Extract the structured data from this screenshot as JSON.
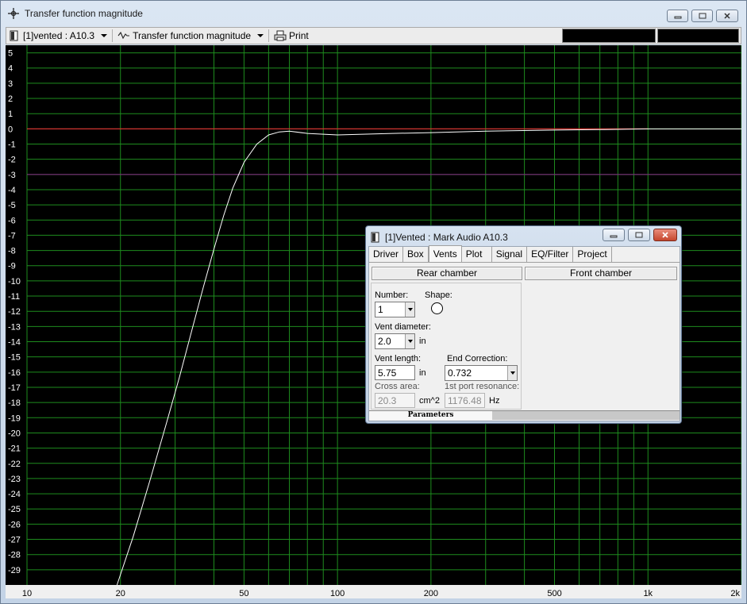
{
  "window": {
    "title": "Transfer function magnitude",
    "icon": "crosshair-icon",
    "caption_buttons": [
      "minimize-icon",
      "maximize-icon",
      "close-icon"
    ]
  },
  "toolbar": {
    "project_selector": "[1]vented : A10.3",
    "view_selector": "Transfer function magnitude",
    "print_label": "Print"
  },
  "dialog": {
    "title": "[1]Vented : Mark Audio A10.3",
    "tabs": [
      "Driver",
      "Box",
      "Vents",
      "Plot",
      "Signal",
      "EQ/Filter",
      "Project"
    ],
    "active_tab": "Vents",
    "rear_chamber_label": "Rear chamber",
    "front_chamber_label": "Front chamber",
    "number_label": "Number:",
    "number_value": "1",
    "shape_label": "Shape:",
    "vent_diameter_label": "Vent diameter:",
    "vent_diameter_value": "2.0",
    "vent_diameter_unit": "in",
    "vent_length_label": "Vent length:",
    "vent_length_value": "5.75",
    "vent_length_unit": "in",
    "end_correction_label": "End Correction:",
    "end_correction_value": "0.732",
    "cross_area_label": "Cross area:",
    "cross_area_value": "20.3",
    "cross_area_unit": "cm^2",
    "port_resonance_label": "1st port resonance:",
    "port_resonance_value": "1176.48",
    "port_resonance_unit": "Hz",
    "bottom_tab_label": "Parameters"
  },
  "chart_data": {
    "type": "line",
    "x_scale": "log",
    "xlim": [
      10,
      2000
    ],
    "ylim": [
      -30,
      5.5
    ],
    "x_tick_labels": [
      {
        "value": 10,
        "label": "10"
      },
      {
        "value": 20,
        "label": "20"
      },
      {
        "value": 50,
        "label": "50"
      },
      {
        "value": 100,
        "label": "100"
      },
      {
        "value": 200,
        "label": "200"
      },
      {
        "value": 500,
        "label": "500"
      },
      {
        "value": 1000,
        "label": "1k"
      },
      {
        "value": 2000,
        "label": "2k"
      }
    ],
    "y_ticks": [
      5,
      4,
      3,
      2,
      1,
      0,
      -1,
      -2,
      -3,
      -4,
      -5,
      -6,
      -7,
      -8,
      -9,
      -10,
      -11,
      -12,
      -13,
      -14,
      -15,
      -16,
      -17,
      -18,
      -19,
      -20,
      -21,
      -22,
      -23,
      -24,
      -25,
      -26,
      -27,
      -28,
      -29
    ],
    "grid": true,
    "reference_lines": [
      {
        "y": 0,
        "color": "#d23030",
        "x_end": 1000
      },
      {
        "y": -3,
        "color": "#7a2a7a"
      }
    ],
    "series": [
      {
        "color": "#ffffff",
        "x": [
          19.5,
          22,
          25,
          28,
          31,
          34,
          37,
          40,
          43,
          46,
          50,
          55,
          60,
          65,
          70,
          80,
          100,
          150,
          200,
          300,
          500,
          700,
          1000,
          1500,
          2000
        ],
        "y": [
          -30,
          -26.8,
          -23,
          -19.5,
          -16.3,
          -13.2,
          -10.4,
          -7.9,
          -5.7,
          -3.9,
          -2.2,
          -1.0,
          -0.4,
          -0.2,
          -0.15,
          -0.3,
          -0.4,
          -0.3,
          -0.25,
          -0.15,
          -0.08,
          -0.05,
          0,
          0,
          0
        ]
      }
    ]
  },
  "colors": {
    "plot_background": "#000000",
    "grid": "#1e8c1e",
    "axis_text": "#ffffff",
    "bottom_axis_text": "#000000"
  }
}
